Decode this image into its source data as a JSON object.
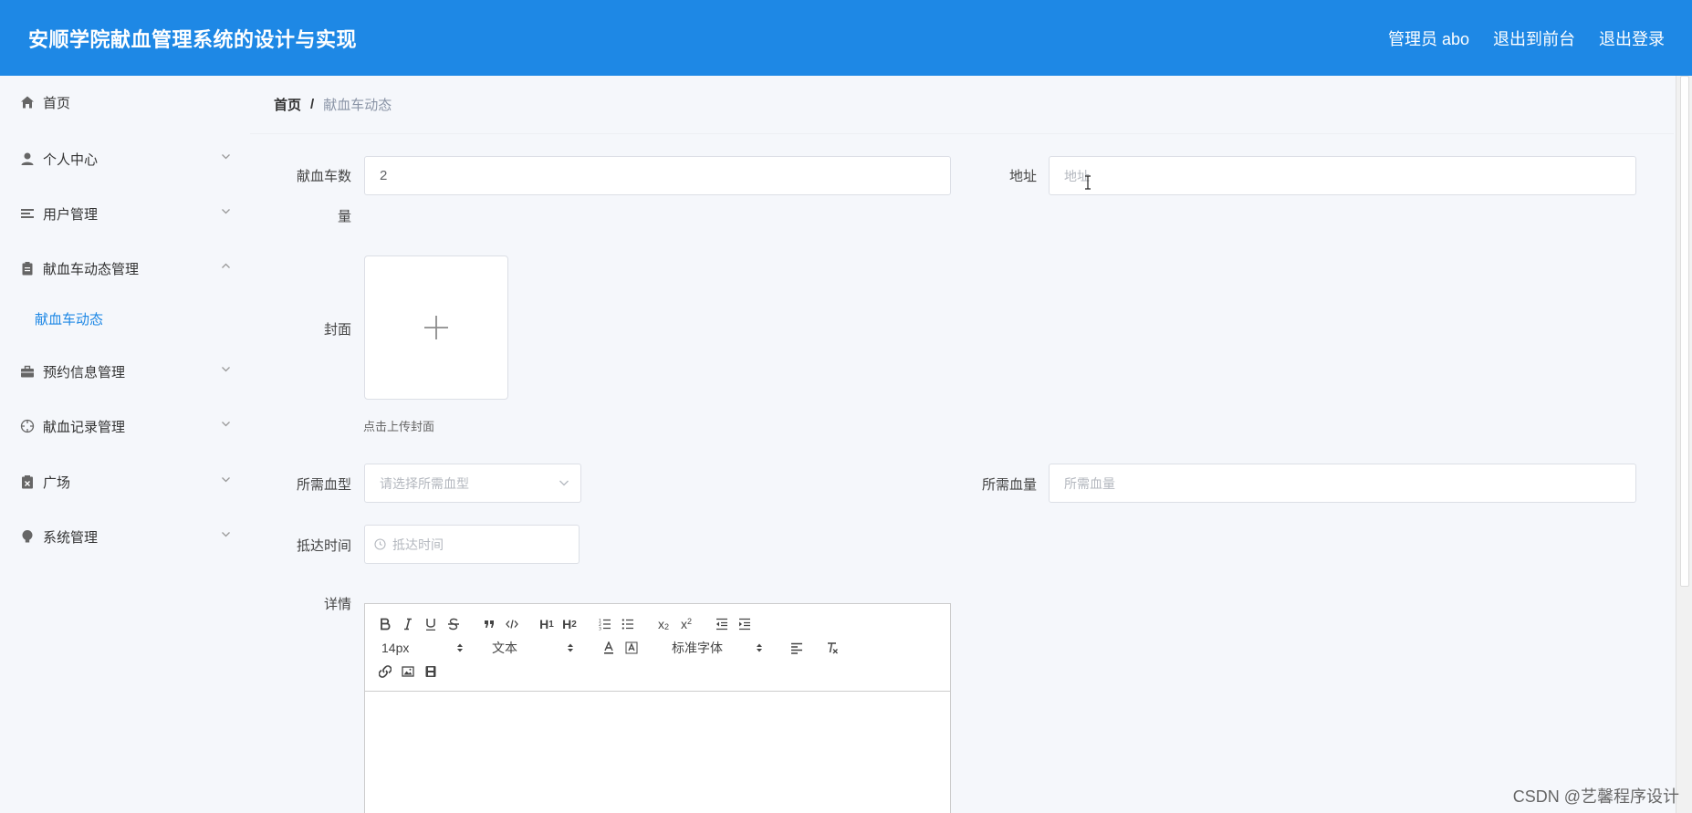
{
  "header": {
    "title": "安顺学院献血管理系统的设计与实现",
    "admin_label": "管理员 abo",
    "back_to_front": "退出到前台",
    "logout": "退出登录",
    "bg_color": "#1e88e5"
  },
  "sidebar": {
    "items": [
      {
        "label": "首页",
        "icon": "home-icon"
      },
      {
        "label": "个人中心",
        "icon": "user-icon"
      },
      {
        "label": "用户管理",
        "icon": "list-icon"
      },
      {
        "label": "献血车动态管理",
        "icon": "clipboard-icon",
        "expanded": true
      },
      {
        "label": "预约信息管理",
        "icon": "briefcase-icon"
      },
      {
        "label": "献血记录管理",
        "icon": "crosshair-icon"
      },
      {
        "label": "广场",
        "icon": "calendar-x-icon"
      },
      {
        "label": "系统管理",
        "icon": "bulb-icon"
      }
    ],
    "sub_item_active": "献血车动态",
    "active_color": "#1e88e5"
  },
  "breadcrumb": {
    "home": "首页",
    "separator": "/",
    "current": "献血车动态"
  },
  "form": {
    "count_label_line1": "献血车数",
    "count_label_line2": "量",
    "count_value": "2",
    "address_label": "地址",
    "address_placeholder": "地址",
    "cover_label": "封面",
    "cover_hint": "点击上传封面",
    "blood_type_label": "所需血型",
    "blood_type_placeholder": "请选择所需血型",
    "blood_amount_label": "所需血量",
    "blood_amount_placeholder": "所需血量",
    "arrival_label": "抵达时间",
    "arrival_placeholder": "抵达时间",
    "detail_label": "详情"
  },
  "editor": {
    "font_size": "14px",
    "block_format": "文本",
    "font_family": "标准字体",
    "buttons": [
      "bold-icon",
      "italic-icon",
      "underline-icon",
      "strike-icon",
      "quote-icon",
      "code-icon",
      "h1-icon",
      "h2-icon",
      "ordered-list-icon",
      "bullet-list-icon",
      "subscript-icon",
      "superscript-icon",
      "outdent-icon",
      "indent-icon",
      "font-color-icon",
      "bg-color-icon",
      "align-icon",
      "clear-format-icon",
      "link-icon",
      "image-icon",
      "video-icon"
    ]
  },
  "watermark": "CSDN @艺馨程序设计"
}
